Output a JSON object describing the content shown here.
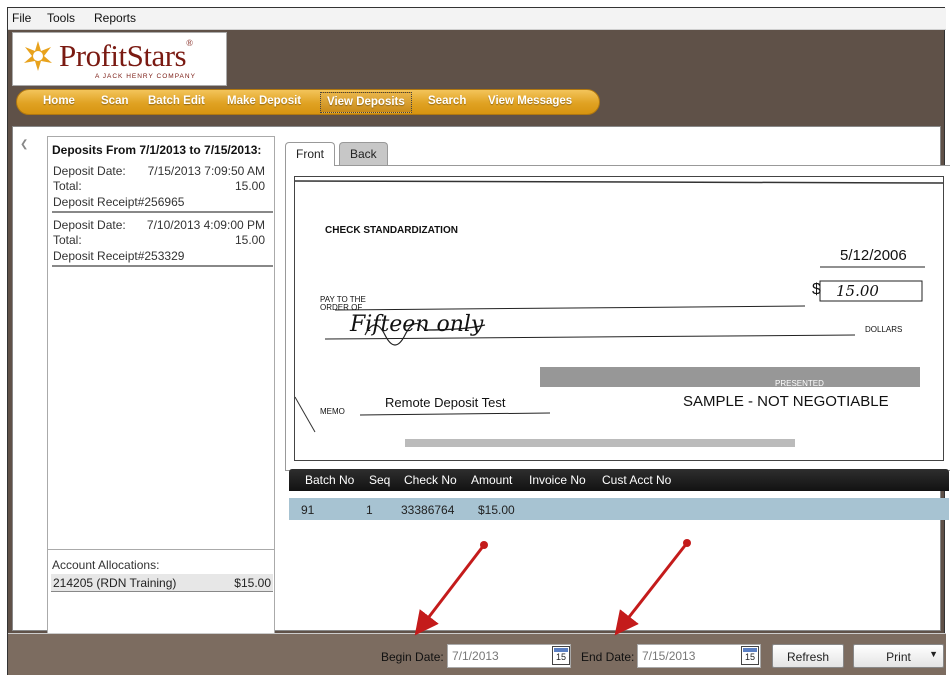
{
  "menu": [
    "File",
    "Tools",
    "Reports"
  ],
  "logo": {
    "brand": "ProfitStars",
    "tm": "®",
    "tagline": "A JACK HENRY COMPANY"
  },
  "nav": [
    "Home",
    "Scan",
    "Batch Edit",
    "Make Deposit",
    "View Deposits",
    "Search",
    "View Messages"
  ],
  "nav_active": "View Deposits",
  "deposits_panel": {
    "header": "Deposits From 7/1/2013 to 7/15/2013:",
    "items": [
      {
        "date_label": "Deposit Date:",
        "date": "7/15/2013 7:09:50 AM",
        "total_label": "Total:",
        "total": "15.00",
        "receipt": "Deposit Receipt#256965"
      },
      {
        "date_label": "Deposit Date:",
        "date": "7/10/2013 4:09:00 PM",
        "total_label": "Total:",
        "total": "15.00",
        "receipt": "Deposit Receipt#253329"
      }
    ]
  },
  "allocations": {
    "title": "Account Allocations:",
    "account": "214205 (RDN Training)",
    "amount": "$15.00"
  },
  "image_tabs": [
    "Front",
    "Back"
  ],
  "check": {
    "heading": "CHECK STANDARDIZATION",
    "date": "5/12/2006",
    "pay_to": "PAY TO THE",
    "order_of": "ORDER OF",
    "dollar_sign": "$",
    "amount": "15.00",
    "written": "Fifteen only",
    "dollars": "DOLLARS",
    "memo_label": "MEMO",
    "memo": "Remote Deposit Test",
    "presented": "PRESENTED",
    "sample": "SAMPLE - NOT NEGOTIABLE"
  },
  "grid": {
    "columns": [
      "Batch No",
      "Seq",
      "Check No",
      "Amount",
      "Invoice No",
      "Cust Acct No"
    ],
    "rows": [
      [
        "91",
        "1",
        "33386764",
        "$15.00",
        "",
        ""
      ]
    ]
  },
  "footer": {
    "begin_label": "Begin Date:",
    "begin_value": "7/1/2013",
    "end_label": "End Date:",
    "end_value": "7/15/2013",
    "calendar_day": "15",
    "refresh": "Refresh",
    "print": "Print"
  },
  "colors": {
    "nav_gold": "#e0a223",
    "chrome_brown": "#5f5148",
    "selection_blue": "#a7c3d2",
    "arrow_red": "#c41b1b"
  }
}
